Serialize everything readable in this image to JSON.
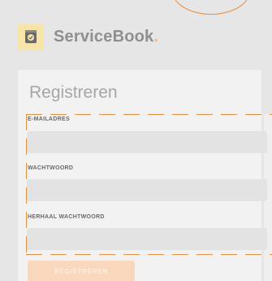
{
  "brand": {
    "name": "ServiceBook",
    "dot": ".",
    "logo_icon": "book-icon"
  },
  "form": {
    "title": "Registreren",
    "email_label": "E-MAILADRES",
    "email_value": "",
    "password_label": "WACHTWOORD",
    "password_value": "",
    "repeat_password_label": "HERHAAL WACHTWOORD",
    "repeat_password_value": "",
    "submit_label": "REGISTREREN"
  },
  "colors": {
    "accent": "#e38f42",
    "button_bg": "#f8d7bd",
    "logo_bg": "#f7e4a8"
  }
}
